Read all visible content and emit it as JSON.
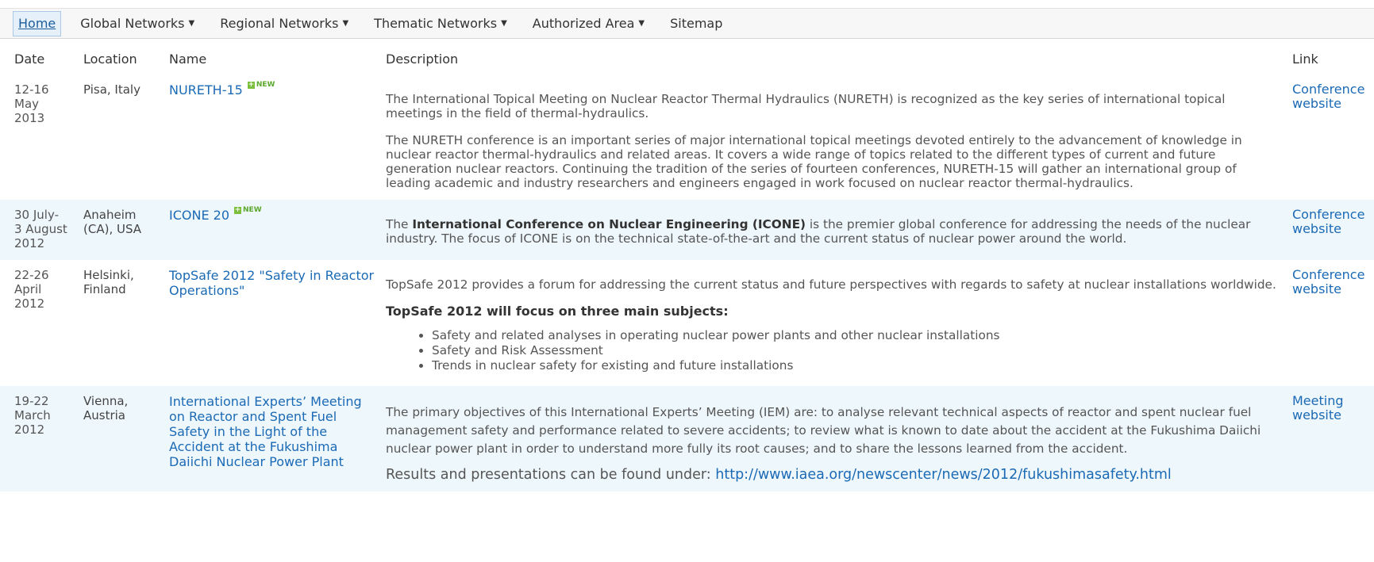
{
  "nav": {
    "home": "Home",
    "global": "Global Networks",
    "regional": "Regional Networks",
    "thematic": "Thematic Networks",
    "authorized": "Authorized Area",
    "sitemap": "Sitemap",
    "caret": "▼"
  },
  "table": {
    "headers": {
      "date": "Date",
      "location": "Location",
      "name": "Name",
      "description": "Description",
      "link": "Link"
    },
    "new_badge": "NEW",
    "rows": [
      {
        "date": [
          "12-16",
          "May",
          "2013"
        ],
        "location": [
          "Pisa, Italy"
        ],
        "name": "NURETH-15",
        "desc": {
          "p1": "The International Topical Meeting on Nuclear Reactor Thermal Hydraulics (NURETH) is recognized as the key series of international topical meetings in the field of thermal-hydraulics.",
          "p2": "The NURETH conference is an important series of major international topical meetings devoted entirely to the advancement of knowledge in nuclear reactor thermal-hydraulics and related areas. It covers a wide range of topics related to the different types of current and future generation nuclear reactors. Continuing the tradition of the series of fourteen conferences, NURETH-15 will gather an international group of leading academic and industry researchers and engineers engaged in work focused on nuclear reactor thermal-hydraulics."
        },
        "link": [
          "Conference",
          "website"
        ]
      },
      {
        "date": [
          "30 July-",
          "3 August",
          "2012"
        ],
        "location": [
          "Anaheim",
          "(CA), USA"
        ],
        "name": "ICONE 20",
        "desc": {
          "pre": "The ",
          "bold": "International Conference on Nuclear Engineering (ICONE)",
          "post": " is the premier global conference for addressing the needs of the nuclear industry. The focus of ICONE is on the technical state-of-the-art and the current status of nuclear power around the world."
        },
        "link": [
          "Conference",
          "website"
        ]
      },
      {
        "date": [
          "22-26",
          "April",
          "2012"
        ],
        "location": [
          "Helsinki,",
          "Finland"
        ],
        "name": "TopSafe 2012 \"Safety in Reactor Operations\"",
        "desc": {
          "p1": "TopSafe 2012 provides a forum for addressing the current status and future perspectives with regards to safety at nuclear installations worldwide.",
          "focus": "TopSafe 2012 will focus on three main subjects:",
          "bullets": [
            "Safety and related analyses in operating nuclear power plants and other nuclear installations",
            "Safety and Risk Assessment",
            "Trends in nuclear safety for existing and future installations"
          ]
        },
        "link": [
          "Conference",
          "website"
        ]
      },
      {
        "date": [
          "19-22",
          "March",
          "2012"
        ],
        "location": [
          "Vienna,",
          "Austria"
        ],
        "name": "International Experts’ Meeting on Reactor and Spent Fuel Safety in the Light of the Accident at the Fukushima Daiichi Nuclear Power Plant",
        "desc": {
          "p1": "The primary objectives of this International Experts’ Meeting (IEM) are: to analyse relevant technical aspects of reactor and spent nuclear fuel management safety and performance related to severe accidents; to review what is known to date about the accident at the Fukushima Daiichi nuclear power plant in order to understand more fully its root causes; and to share the lessons learned from the accident.",
          "results_label": "Results and presentations can be found under: ",
          "results_url": "http://www.iaea.org/newscenter/news/2012/fukushimasafety.html"
        },
        "link": [
          "Meeting",
          "website"
        ]
      }
    ]
  }
}
